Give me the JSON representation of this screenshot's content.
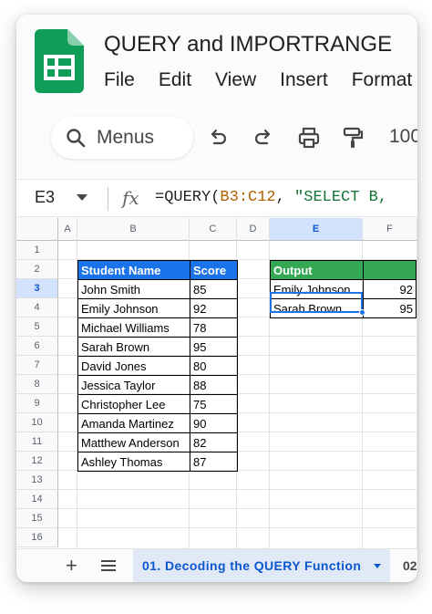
{
  "header": {
    "title": "QUERY and IMPORTRANGE",
    "menu": [
      "File",
      "Edit",
      "View",
      "Insert",
      "Format"
    ]
  },
  "toolbar": {
    "search_label": "Menus",
    "zoom": "100"
  },
  "formula_bar": {
    "name_box": "E3",
    "fx": "fx",
    "formula_prefix": "=QUERY(",
    "formula_range": "B3:C12",
    "formula_sep": ", ",
    "formula_string": "\"SELECT B,"
  },
  "grid": {
    "columns": [
      "A",
      "B",
      "C",
      "D",
      "E",
      "F"
    ],
    "rows": [
      "1",
      "2",
      "3",
      "4",
      "5",
      "6",
      "7",
      "8",
      "9",
      "10",
      "11",
      "12",
      "13",
      "14",
      "15",
      "16"
    ],
    "selected_column": "E",
    "selected_row": "3"
  },
  "student_table": {
    "headers": [
      "Student Name",
      "Score"
    ],
    "rows": [
      [
        "John Smith",
        "85"
      ],
      [
        "Emily Johnson",
        "92"
      ],
      [
        "Michael Williams",
        "78"
      ],
      [
        "Sarah Brown",
        "95"
      ],
      [
        "David Jones",
        "80"
      ],
      [
        "Jessica Taylor",
        "88"
      ],
      [
        "Christopher Lee",
        "75"
      ],
      [
        "Amanda Martinez",
        "90"
      ],
      [
        "Matthew Anderson",
        "82"
      ],
      [
        "Ashley Thomas",
        "87"
      ]
    ]
  },
  "output_table": {
    "header": "Output",
    "rows": [
      [
        "Emily Johnson",
        "92"
      ],
      [
        "Sarah Brown",
        "95"
      ]
    ]
  },
  "sheet_bar": {
    "active_tab": "01. Decoding the QUERY Function",
    "next_tab": "02"
  },
  "colors": {
    "header_blue": "#1a73e8",
    "header_green": "#34a853",
    "selection": "#1a73e8"
  }
}
